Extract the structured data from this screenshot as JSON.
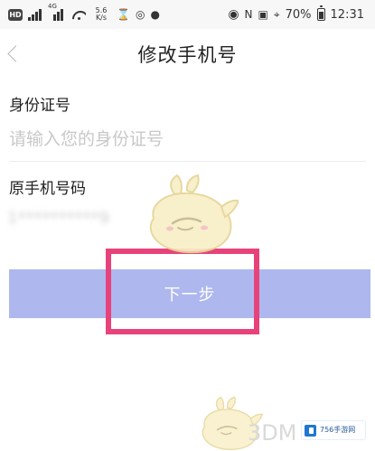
{
  "status_bar": {
    "left": {
      "hd": "HD",
      "network_small": "4G",
      "speed": "5.6\nK/s"
    },
    "right": {
      "battery": "70%",
      "time": "12:31"
    },
    "icons": [
      "hd-icon",
      "signal-icon",
      "signal-icon",
      "wifi-icon",
      "hourglass-icon",
      "alarm-icon",
      "chat-icon",
      "eye-icon",
      "nfc-icon",
      "vibrate-icon",
      "location-icon",
      "battery-icon"
    ]
  },
  "header": {
    "title": "修改手机号",
    "back_icon": "chevron-left-icon"
  },
  "form": {
    "id_label": "身份证号",
    "id_placeholder": "请输入您的身份证号",
    "phone_label": "原手机号码",
    "phone_value": "1**********9"
  },
  "action": {
    "next_label": "下一步"
  },
  "watermark": {
    "brand": "3DM",
    "site_badge": "756手游网"
  },
  "colors": {
    "button": "#aeb8ee",
    "highlight": "#e8427b",
    "placeholder": "#c8c8c8"
  }
}
